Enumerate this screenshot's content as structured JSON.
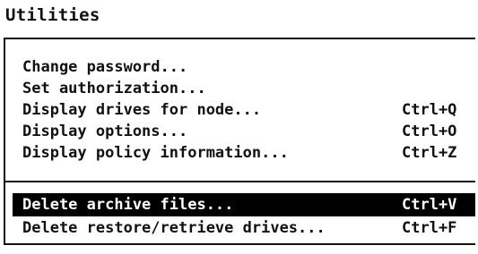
{
  "menu": {
    "title": "Utilities",
    "groups": [
      {
        "items": [
          {
            "label": "Change password...",
            "shortcut": ""
          },
          {
            "label": "Set authorization...",
            "shortcut": ""
          },
          {
            "label": "Display drives for node...",
            "shortcut": "Ctrl+Q"
          },
          {
            "label": "Display options...",
            "shortcut": "Ctrl+O"
          },
          {
            "label": "Display policy information...",
            "shortcut": "Ctrl+Z"
          }
        ]
      },
      {
        "items": [
          {
            "label": "Delete archive files...",
            "shortcut": "Ctrl+V",
            "selected": true
          },
          {
            "label": "Delete restore/retrieve drives...",
            "shortcut": "Ctrl+F"
          }
        ]
      }
    ],
    "colors": {
      "selection_background": "#000000",
      "selection_text": "#ffffff",
      "text": "#111111",
      "background": "#ffffff"
    }
  }
}
